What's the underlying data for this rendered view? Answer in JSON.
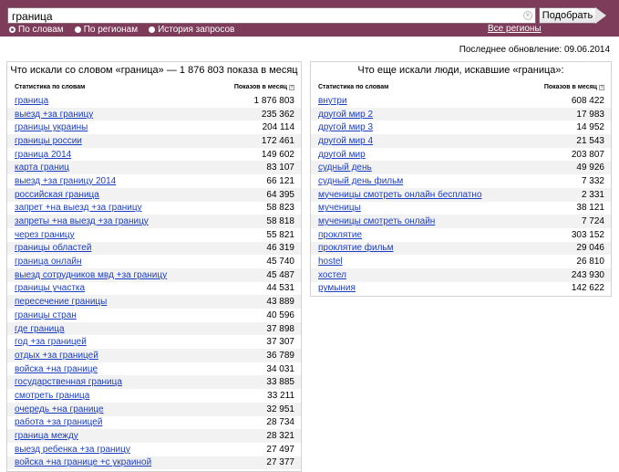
{
  "search": {
    "value": "граница",
    "submit_label": "Подобрать"
  },
  "tabs": [
    {
      "label": "По словам",
      "selected": true
    },
    {
      "label": "По регионам",
      "selected": false
    },
    {
      "label": "История запросов",
      "selected": false
    }
  ],
  "all_regions_label": "Все регионы",
  "updated_text": "Последнее обновление: 09.06.2014",
  "left_panel": {
    "title": "Что искали со словом «граница» — 1 876 803 показа в месяц",
    "col_stat": "Статистика по словам",
    "col_shows": "Показов в месяц",
    "rows": [
      {
        "q": "граница",
        "n": "1 876 803"
      },
      {
        "q": "выезд +за границу",
        "n": "235 362"
      },
      {
        "q": "границы украины",
        "n": "204 114"
      },
      {
        "q": "границы россии",
        "n": "172 461"
      },
      {
        "q": "граница 2014",
        "n": "149 602"
      },
      {
        "q": "карта границ",
        "n": "83 107"
      },
      {
        "q": "выезд +за границу 2014",
        "n": "66 121"
      },
      {
        "q": "российская граница",
        "n": "64 395"
      },
      {
        "q": "запрет +на выезд +за границу",
        "n": "58 823"
      },
      {
        "q": "запреты +на выезд +за границу",
        "n": "58 818"
      },
      {
        "q": "через границу",
        "n": "55 821"
      },
      {
        "q": "границы областей",
        "n": "46 319"
      },
      {
        "q": "граница онлайн",
        "n": "45 740"
      },
      {
        "q": "выезд сотрудников мвд +за границу",
        "n": "45 487"
      },
      {
        "q": "границы участка",
        "n": "44 531"
      },
      {
        "q": "пересечение границы",
        "n": "43 889"
      },
      {
        "q": "границы стран",
        "n": "40 596"
      },
      {
        "q": "где граница",
        "n": "37 898"
      },
      {
        "q": "год +за границей",
        "n": "37 307"
      },
      {
        "q": "отдых +за границей",
        "n": "36 789"
      },
      {
        "q": "войска +на границе",
        "n": "34 031"
      },
      {
        "q": "государственная граница",
        "n": "33 885"
      },
      {
        "q": "смотреть граница",
        "n": "33 211"
      },
      {
        "q": "очередь +на границе",
        "n": "32 951"
      },
      {
        "q": "работа +за границей",
        "n": "28 734"
      },
      {
        "q": "граница между",
        "n": "28 321"
      },
      {
        "q": "выезд ребенка +за границу",
        "n": "27 497"
      },
      {
        "q": "войска +на границе +с украиной",
        "n": "27 377"
      }
    ]
  },
  "right_panel": {
    "title": "Что еще искали люди, искавшие «граница»:",
    "col_stat": "Статистика по словам",
    "col_shows": "Показов в месяц",
    "rows": [
      {
        "q": "внутри",
        "n": "608 422"
      },
      {
        "q": "другой мир 2",
        "n": "17 983"
      },
      {
        "q": "другой мир 3",
        "n": "14 952"
      },
      {
        "q": "другой мир 4",
        "n": "21 543"
      },
      {
        "q": "другой мир",
        "n": "203 807"
      },
      {
        "q": "судный день",
        "n": "49 926"
      },
      {
        "q": "судный день фильм",
        "n": "7 332"
      },
      {
        "q": "мученицы смотреть онлайн бесплатно",
        "n": "2 331"
      },
      {
        "q": "мученицы",
        "n": "38 121"
      },
      {
        "q": "мученицы смотреть онлайн",
        "n": "7 724"
      },
      {
        "q": "проклятие",
        "n": "303 152"
      },
      {
        "q": "проклятие фильм",
        "n": "29 046"
      },
      {
        "q": "hostel",
        "n": "26 810"
      },
      {
        "q": "хостел",
        "n": "243 930"
      },
      {
        "q": "румыния",
        "n": "142 622"
      }
    ]
  }
}
